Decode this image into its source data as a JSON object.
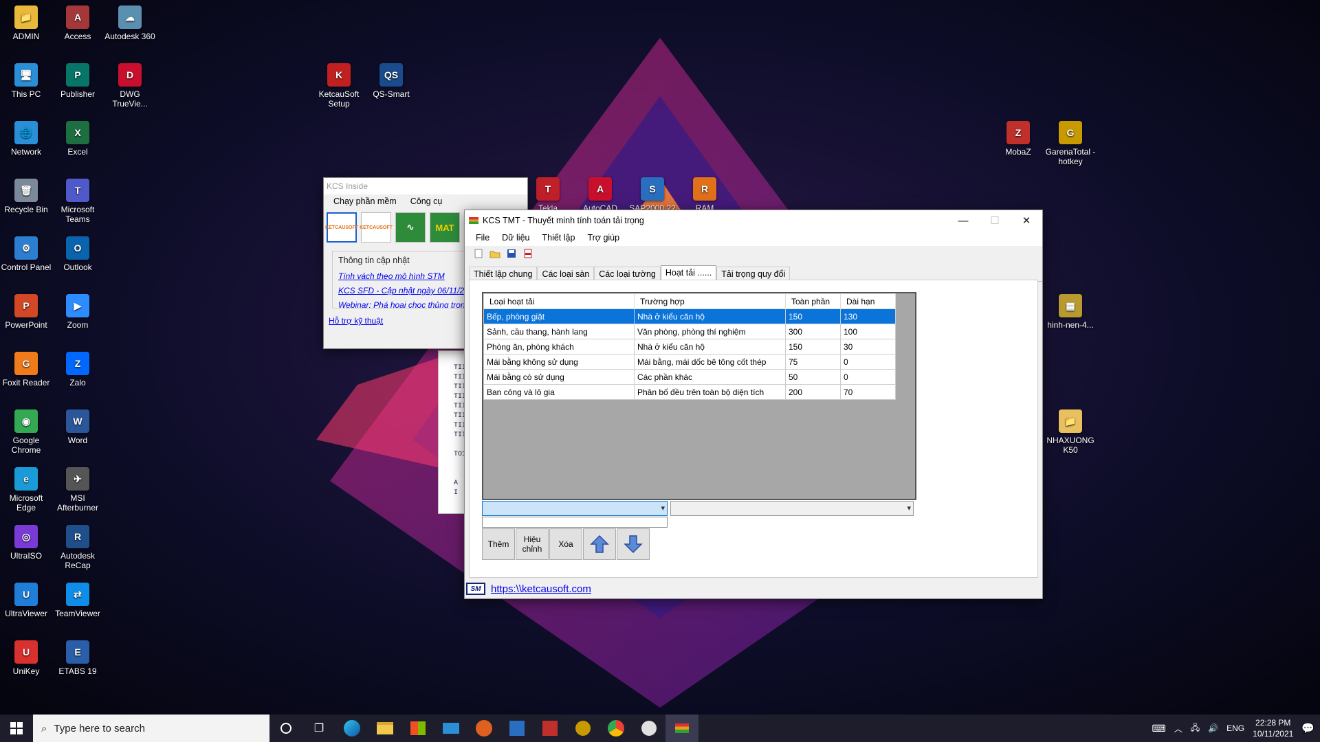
{
  "desktop": {
    "icons_col1": [
      {
        "label": "ADMIN",
        "glyph": "📁",
        "color": "#e8b93a"
      },
      {
        "label": "This PC",
        "glyph": "🖥",
        "color": "#2a8fd6"
      },
      {
        "label": "Network",
        "glyph": "🌐",
        "color": "#2a8fd6"
      },
      {
        "label": "Recycle Bin",
        "glyph": "🗑",
        "color": "#7a8a9a"
      },
      {
        "label": "Control Panel",
        "glyph": "⚙",
        "color": "#2c7fd0"
      },
      {
        "label": "PowerPoint",
        "glyph": "P",
        "color": "#d24726"
      },
      {
        "label": "Foxit Reader",
        "glyph": "G",
        "color": "#f07b1a"
      },
      {
        "label": "Google Chrome",
        "glyph": "◉",
        "color": "#34a853"
      },
      {
        "label": "Microsoft Edge",
        "glyph": "e",
        "color": "#1a9bd7"
      },
      {
        "label": "UltraISO",
        "glyph": "◎",
        "color": "#7a3ad6"
      },
      {
        "label": "UltraViewer",
        "glyph": "U",
        "color": "#1f7fd8"
      },
      {
        "label": "UniKey",
        "glyph": "U",
        "color": "#d93030"
      }
    ],
    "icons_col2": [
      {
        "label": "Access",
        "glyph": "A",
        "color": "#a4373a"
      },
      {
        "label": "Publisher",
        "glyph": "P",
        "color": "#077568"
      },
      {
        "label": "Excel",
        "glyph": "X",
        "color": "#1d6f42"
      },
      {
        "label": "Microsoft Teams",
        "glyph": "T",
        "color": "#5059c9"
      },
      {
        "label": "Outlook",
        "glyph": "O",
        "color": "#0a64ad"
      },
      {
        "label": "Zoom",
        "glyph": "▶",
        "color": "#2d8cff"
      },
      {
        "label": "Zalo",
        "glyph": "Z",
        "color": "#0068ff"
      },
      {
        "label": "Word",
        "glyph": "W",
        "color": "#2b579a"
      },
      {
        "label": "MSI Afterburner",
        "glyph": "✈",
        "color": "#555"
      },
      {
        "label": "Autodesk ReCap",
        "glyph": "R",
        "color": "#1e4f8a"
      },
      {
        "label": "TeamViewer",
        "glyph": "⇄",
        "color": "#0e8ee9"
      },
      {
        "label": "ETABS 19",
        "glyph": "E",
        "color": "#2a5ea8"
      }
    ],
    "icons_col3": [
      {
        "label": "Autodesk 360",
        "glyph": "☁",
        "color": "#5a8fb0"
      },
      {
        "label": "DWG TrueVie...",
        "glyph": "D",
        "color": "#c8102e"
      }
    ],
    "icons_extra": [
      {
        "label": "KetcauSoft Setup",
        "glyph": "K",
        "color": "#c02020"
      },
      {
        "label": "QS-Smart",
        "glyph": "QS",
        "color": "#1a4b8c"
      },
      {
        "label": "MobaZ",
        "glyph": "Z",
        "color": "#c0302b"
      },
      {
        "label": "GarenaTotal - hotkey",
        "glyph": "G",
        "color": "#c89a00"
      },
      {
        "label": "hinh-nen-4...",
        "glyph": "▦",
        "color": "#b89a30"
      },
      {
        "label": "NHAXUONG K50",
        "glyph": "📁",
        "color": "#e8c060"
      }
    ],
    "icons_partial": [
      {
        "label": "Tekla",
        "glyph": "T",
        "color": "#c0202a"
      },
      {
        "label": "AutoCAD",
        "glyph": "A",
        "color": "#c8102e"
      },
      {
        "label": "SAP2000 22",
        "glyph": "S",
        "color": "#2a6fbf"
      },
      {
        "label": "RAM",
        "glyph": "R",
        "color": "#e0701a"
      }
    ]
  },
  "kcs_inside": {
    "title": "KCS Inside",
    "menu": [
      "Chạy phần mềm",
      "Công cụ"
    ],
    "tools": [
      "KETCAUSOFT",
      "KETCAUSOFT",
      "∿",
      "MAT"
    ],
    "group_title": "Thông tin cập nhật",
    "links": [
      "Tính vách theo mô hình STM",
      "KCS SFD - Cập nhật ngày 06/11/20",
      "Webinar: Phá hoại chọc thủng tron"
    ],
    "support_link": "Hỗ trợ kỹ thuật"
  },
  "behind_text": [
    "TII",
    "TII",
    "TII",
    "TII",
    "TII",
    "TII",
    "TII",
    "TII",
    "",
    "TO1",
    "",
    "",
    "A I"
  ],
  "kcs_tmt": {
    "title": "KCS TMT - Thuyết minh tính toán tải trọng",
    "window_controls": [
      "—",
      "☐",
      "✕"
    ],
    "menu": [
      "File",
      "Dữ liệu",
      "Thiết lập",
      "Trợ giúp"
    ],
    "tabs": [
      "Thiết lập chung",
      "Các loại sàn",
      "Các loại tường",
      "Hoạt tải ......",
      "Tải trọng quy đổi"
    ],
    "active_tab": 3,
    "grid": {
      "headers": [
        "Loại hoạt tải",
        "Trường hợp",
        "Toàn phần",
        "Dài hạn"
      ],
      "rows": [
        [
          "Bếp, phòng giặt",
          "Nhà ở kiểu căn hộ",
          "150",
          "130"
        ],
        [
          "Sảnh, cầu thang, hành lang",
          "Văn phòng, phòng thí nghiệm",
          "300",
          "100"
        ],
        [
          "Phòng ăn, phòng khách",
          "Nhà ở kiểu căn hộ",
          "150",
          "30"
        ],
        [
          "Mái bằng không sử dụng",
          "Mái bằng, mái dốc bê tông cốt thép",
          "75",
          "0"
        ],
        [
          "Mái bằng có sử dụng",
          "Các phần khác",
          "50",
          "0"
        ],
        [
          "Ban công và lô gia",
          "Phân bố đều trên toàn bộ diện tích",
          "200",
          "70"
        ]
      ],
      "selected_row": 0
    },
    "buttons": {
      "add": "Thêm",
      "edit": "Hiệu chỉnh",
      "delete": "Xóa"
    },
    "status_badge": "SM",
    "status_link": "https:\\\\ketcausoft.com"
  },
  "taskbar": {
    "search_placeholder": "Type here to search",
    "lang": "ENG",
    "time": "22:28 PM",
    "date": "10/11/2021"
  }
}
